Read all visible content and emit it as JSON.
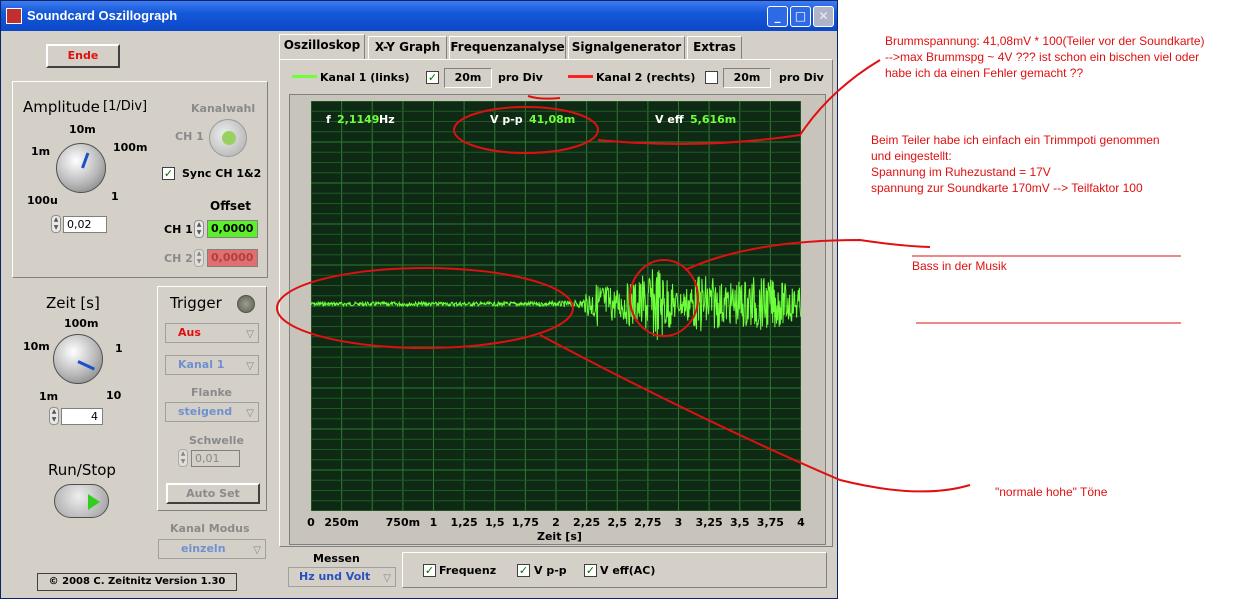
{
  "window": {
    "title": "Soundcard Oszillograph",
    "minimize_label": "_",
    "maximize_label": "□",
    "close_label": "✕"
  },
  "left": {
    "ende_label": "Ende",
    "amplitude_title": "Amplitude",
    "amplitude_unit": "[1/Div]",
    "amplitude_ticks": [
      "10m",
      "1m",
      "100m",
      "100u",
      "1"
    ],
    "amplitude_value": "0,02",
    "kanalwahl_label": "Kanalwahl",
    "ch1_toggle_label": "CH 1",
    "sync_label": "Sync CH 1&2",
    "offset_label": "Offset",
    "ch1_label": "CH 1",
    "ch1_offset": "0,0000",
    "ch2_label": "CH 2",
    "ch2_offset": "0,0000",
    "zeit_title": "Zeit [s]",
    "zeit_ticks": [
      "100m",
      "10m",
      "1",
      "1m",
      "10"
    ],
    "zeit_value": "4",
    "trigger_title": "Trigger",
    "trigger_mode": "Aus",
    "trigger_channel": "Kanal 1",
    "flanke_label": "Flanke",
    "flanke_value": "steigend",
    "schwelle_label": "Schwelle",
    "schwelle_value": "0,01",
    "autoset_label": "Auto Set",
    "runstop_label": "Run/Stop",
    "kanalmodus_label": "Kanal Modus",
    "kanalmodus_value": "einzeln",
    "copyright": "© 2008  C. Zeitnitz Version 1.30"
  },
  "tabs": [
    "Oszilloskop",
    "X-Y Graph",
    "Frequenzanalyse",
    "Signalgenerator",
    "Extras"
  ],
  "legend": {
    "ch1_label": "Kanal 1 (links)",
    "ch1_color": "#6dff3a",
    "ch1_checked": true,
    "ch1_div": "20m",
    "ch2_label": "Kanal 2 (rechts)",
    "ch2_color": "#ff2020",
    "ch2_checked": false,
    "ch2_div": "20m",
    "pro_div": "pro Div"
  },
  "readout": {
    "f_label": "f",
    "f_value": "2,1149",
    "f_unit": "Hz",
    "vpp_label": "V p-p",
    "vpp_value": "41,08m",
    "veff_label": "V eff",
    "veff_value": "5,616m"
  },
  "chart_data": {
    "type": "line",
    "xlabel": "Zeit [s]",
    "x_ticks": [
      "0",
      "250m",
      "750m",
      "1",
      "1,25",
      "1,5",
      "1,75",
      "2",
      "2,25",
      "2,5",
      "2,75",
      "3",
      "3,25",
      "3,5",
      "3,75",
      "4"
    ],
    "xlim": [
      0,
      4
    ],
    "grid": true,
    "background": "#0e2a14",
    "series": [
      {
        "name": "Kanal 1 (links)",
        "color": "#6dff3a",
        "description_points": {
          "x": [
            0,
            0.5,
            1.0,
            1.5,
            2.0,
            2.2,
            2.35,
            2.5,
            2.7,
            2.85,
            3.0,
            3.2,
            3.4,
            3.6,
            3.8,
            4.0
          ],
          "amplitude": [
            0.05,
            0.05,
            0.05,
            0.05,
            0.06,
            0.1,
            0.6,
            0.4,
            0.7,
            1.0,
            0.3,
            0.8,
            0.5,
            0.7,
            0.6,
            0.4
          ]
        }
      }
    ]
  },
  "measure": {
    "messen_label": "Messen",
    "messen_value": "Hz und Volt",
    "frequenz_label": "Frequenz",
    "vpp_label": "V p-p",
    "veff_label": "V eff(AC)"
  },
  "annotations": {
    "note1_lines": [
      "Brummspannung: 41,08mV * 100(Teiler vor der Soundkarte)",
      "-->max Brummspg ~ 4V ??? ist schon ein bischen viel oder",
      "habe ich da einen Fehler gemacht ??"
    ],
    "note2_lines": [
      "Beim Teiler habe ich einfach ein Trimmpoti genommen",
      "und eingestellt:",
      "Spannung im Ruhezustand = 17V",
      "spannung zur Soundkarte 170mV --> Teilfaktor 100"
    ],
    "bass_label": "Bass in der Musik",
    "hohe_label": "\"normale hohe\" Töne",
    "color": "#e01010"
  }
}
